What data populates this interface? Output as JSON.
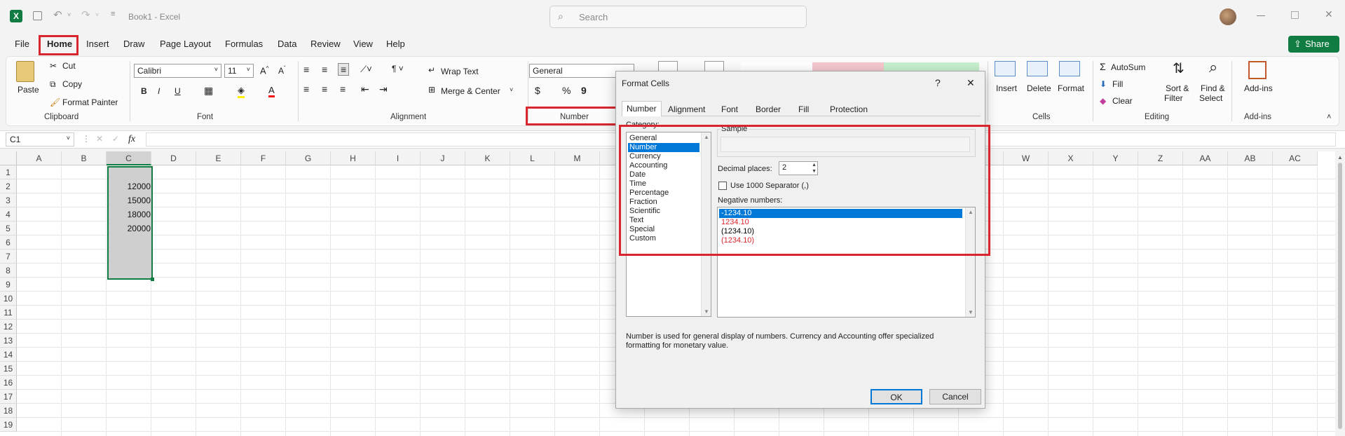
{
  "titlebar": {
    "doc_title": "Book1 - Excel",
    "search_placeholder": "Search"
  },
  "menu": {
    "items": [
      "File",
      "Home",
      "Insert",
      "Draw",
      "Page Layout",
      "Formulas",
      "Data",
      "Review",
      "View",
      "Help"
    ],
    "share": "Share"
  },
  "ribbon": {
    "clipboard": {
      "paste": "Paste",
      "cut": "Cut",
      "copy": "Copy",
      "format_painter": "Format Painter",
      "label": "Clipboard"
    },
    "font": {
      "font_name": "Calibri",
      "font_size": "11",
      "label": "Font",
      "grow": "A^",
      "shrink": "A˅"
    },
    "alignment": {
      "wrap_text": "Wrap Text",
      "merge_center": "Merge & Center",
      "label": "Alignment"
    },
    "number": {
      "format": "General",
      "label": "Number",
      "currency": "$",
      "percent": "%",
      "comma": "9"
    },
    "cells": {
      "insert": "Insert",
      "delete": "Delete",
      "format": "Format",
      "label": "Cells"
    },
    "editing": {
      "autosum": "AutoSum",
      "fill": "Fill",
      "clear": "Clear",
      "sort_filter_1": "Sort &",
      "sort_filter_2": "Filter",
      "find_select_1": "Find &",
      "find_select_2": "Select",
      "label": "Editing"
    },
    "addins": {
      "addins": "Add-ins",
      "label": "Add-ins"
    }
  },
  "formula_bar": {
    "name_box": "C1",
    "fx": "fx",
    "value": ""
  },
  "grid": {
    "columns": [
      "A",
      "B",
      "C",
      "D",
      "E",
      "F",
      "G",
      "H",
      "I",
      "J",
      "K",
      "L",
      "M",
      "N",
      "O",
      "P",
      "Q",
      "R",
      "S",
      "T",
      "U",
      "V",
      "W",
      "X",
      "Y",
      "Z",
      "AA",
      "AB",
      "AC"
    ],
    "rows": [
      "1",
      "2",
      "3",
      "4",
      "5",
      "6",
      "7",
      "8",
      "9",
      "10",
      "11",
      "12",
      "13",
      "14",
      "15",
      "16",
      "17",
      "18",
      "19"
    ],
    "c_values": [
      "",
      "12000",
      "15000",
      "18000",
      "20000",
      "",
      "",
      ""
    ]
  },
  "dialog": {
    "title": "Format Cells",
    "help": "?",
    "close": "✕",
    "tabs": [
      "Number",
      "Alignment",
      "Font",
      "Border",
      "Fill",
      "Protection"
    ],
    "category_label": "Category:",
    "categories": [
      "General",
      "Number",
      "Currency",
      "Accounting",
      "Date",
      "Time",
      "Percentage",
      "Fraction",
      "Scientific",
      "Text",
      "Special",
      "Custom"
    ],
    "selected_category": "Number",
    "sample_label": "Sample",
    "decimal_label": "Decimal places:",
    "decimal_value": "2",
    "separator_label": "Use 1000 Separator (,)",
    "negative_label": "Negative numbers:",
    "negative_options": [
      {
        "text": "-1234.10",
        "color": "#000000",
        "selected": true
      },
      {
        "text": "1234.10",
        "color": "#d7262d",
        "selected": false
      },
      {
        "text": "(1234.10)",
        "color": "#000000",
        "selected": false
      },
      {
        "text": "(1234.10)",
        "color": "#d7262d",
        "selected": false
      }
    ],
    "description_1": "Number is used for general display of numbers.  Currency and Accounting offer specialized",
    "description_2": "formatting for monetary value.",
    "ok": "OK",
    "cancel": "Cancel"
  },
  "colors": {
    "excel_green": "#107c41",
    "selection_blue": "#0078d7",
    "annotation_red": "#d7262d"
  }
}
